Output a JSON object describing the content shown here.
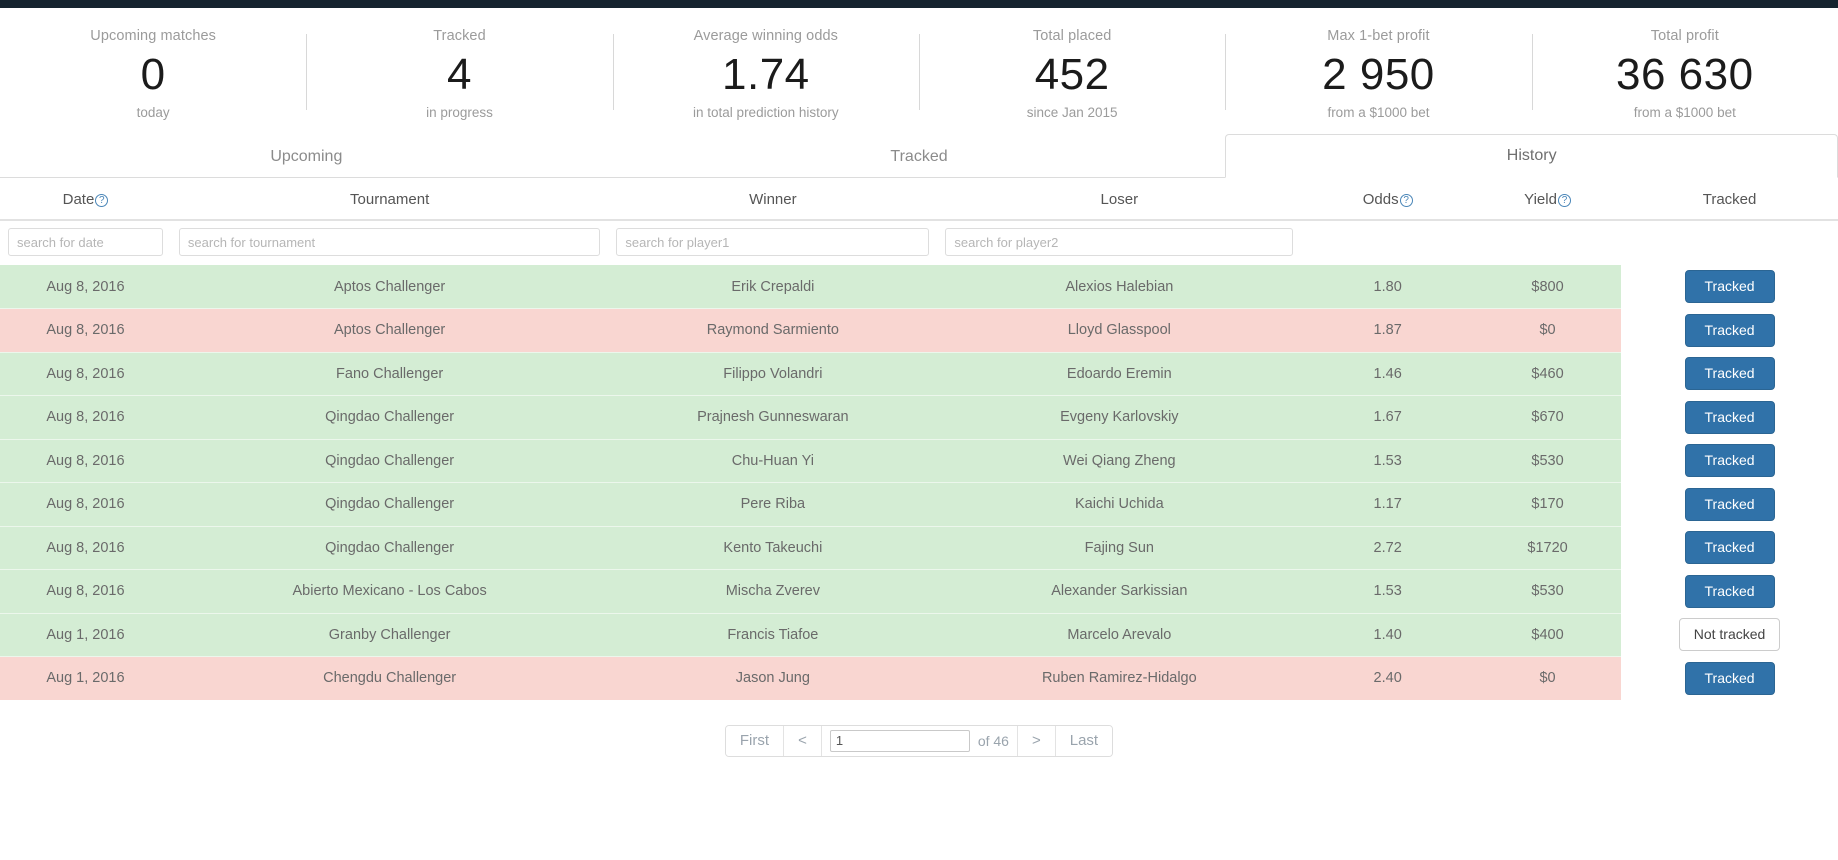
{
  "stats": [
    {
      "label": "Upcoming matches",
      "value": "0",
      "sub": "today"
    },
    {
      "label": "Tracked",
      "value": "4",
      "sub": "in progress"
    },
    {
      "label": "Average winning odds",
      "value": "1.74",
      "sub": "in total prediction history"
    },
    {
      "label": "Total placed",
      "value": "452",
      "sub": "since Jan 2015"
    },
    {
      "label": "Max 1-bet profit",
      "value": "2 950",
      "sub": "from a $1000 bet"
    },
    {
      "label": "Total profit",
      "value": "36 630",
      "sub": "from a $1000 bet"
    }
  ],
  "tabs": [
    {
      "label": "Upcoming",
      "active": false
    },
    {
      "label": "Tracked",
      "active": false
    },
    {
      "label": "History",
      "active": true
    }
  ],
  "table": {
    "columns": [
      {
        "label": "Date",
        "help": true
      },
      {
        "label": "Tournament",
        "help": false
      },
      {
        "label": "Winner",
        "help": false
      },
      {
        "label": "Loser",
        "help": false
      },
      {
        "label": "Odds",
        "help": true
      },
      {
        "label": "Yield",
        "help": true
      },
      {
        "label": "Tracked",
        "help": false
      }
    ],
    "filters": [
      {
        "placeholder": "search for date",
        "value": ""
      },
      {
        "placeholder": "search for tournament",
        "value": ""
      },
      {
        "placeholder": "search for player1",
        "value": ""
      },
      {
        "placeholder": "search for player2",
        "value": ""
      }
    ],
    "rows": [
      {
        "date": "Aug 8, 2016",
        "tournament": "Aptos Challenger",
        "winner": "Erik Crepaldi",
        "loser": "Alexios Halebian",
        "odds": "1.80",
        "yield": "$800",
        "tracked_label": "Tracked",
        "tracked": true,
        "result": "win"
      },
      {
        "date": "Aug 8, 2016",
        "tournament": "Aptos Challenger",
        "winner": "Raymond Sarmiento",
        "loser": "Lloyd Glasspool",
        "odds": "1.87",
        "yield": "$0",
        "tracked_label": "Tracked",
        "tracked": true,
        "result": "loss"
      },
      {
        "date": "Aug 8, 2016",
        "tournament": "Fano Challenger",
        "winner": "Filippo Volandri",
        "loser": "Edoardo Eremin",
        "odds": "1.46",
        "yield": "$460",
        "tracked_label": "Tracked",
        "tracked": true,
        "result": "win"
      },
      {
        "date": "Aug 8, 2016",
        "tournament": "Qingdao Challenger",
        "winner": "Prajnesh Gunneswaran",
        "loser": "Evgeny Karlovskiy",
        "odds": "1.67",
        "yield": "$670",
        "tracked_label": "Tracked",
        "tracked": true,
        "result": "win"
      },
      {
        "date": "Aug 8, 2016",
        "tournament": "Qingdao Challenger",
        "winner": "Chu-Huan Yi",
        "loser": "Wei Qiang Zheng",
        "odds": "1.53",
        "yield": "$530",
        "tracked_label": "Tracked",
        "tracked": true,
        "result": "win"
      },
      {
        "date": "Aug 8, 2016",
        "tournament": "Qingdao Challenger",
        "winner": "Pere Riba",
        "loser": "Kaichi Uchida",
        "odds": "1.17",
        "yield": "$170",
        "tracked_label": "Tracked",
        "tracked": true,
        "result": "win"
      },
      {
        "date": "Aug 8, 2016",
        "tournament": "Qingdao Challenger",
        "winner": "Kento Takeuchi",
        "loser": "Fajing Sun",
        "odds": "2.72",
        "yield": "$1720",
        "tracked_label": "Tracked",
        "tracked": true,
        "result": "win"
      },
      {
        "date": "Aug 8, 2016",
        "tournament": "Abierto Mexicano - Los Cabos",
        "winner": "Mischa Zverev",
        "loser": "Alexander Sarkissian",
        "odds": "1.53",
        "yield": "$530",
        "tracked_label": "Tracked",
        "tracked": true,
        "result": "win"
      },
      {
        "date": "Aug 1, 2016",
        "tournament": "Granby Challenger",
        "winner": "Francis Tiafoe",
        "loser": "Marcelo Arevalo",
        "odds": "1.40",
        "yield": "$400",
        "tracked_label": "Not tracked",
        "tracked": false,
        "result": "win"
      },
      {
        "date": "Aug 1, 2016",
        "tournament": "Chengdu Challenger",
        "winner": "Jason Jung",
        "loser": "Ruben Ramirez-Hidalgo",
        "odds": "2.40",
        "yield": "$0",
        "tracked_label": "Tracked",
        "tracked": true,
        "result": "loss"
      }
    ]
  },
  "pagination": {
    "first_label": "First",
    "prev_label": "<",
    "page_value": "1",
    "page_placeholder": "",
    "of_label": "of 46",
    "next_label": ">",
    "last_label": "Last"
  },
  "colors": {
    "topbar": "#16242f",
    "win_row": "#d4edd4",
    "loss_row": "#f9d6d1",
    "primary_button": "#3072a9",
    "help_icon": "#4a86b8"
  }
}
